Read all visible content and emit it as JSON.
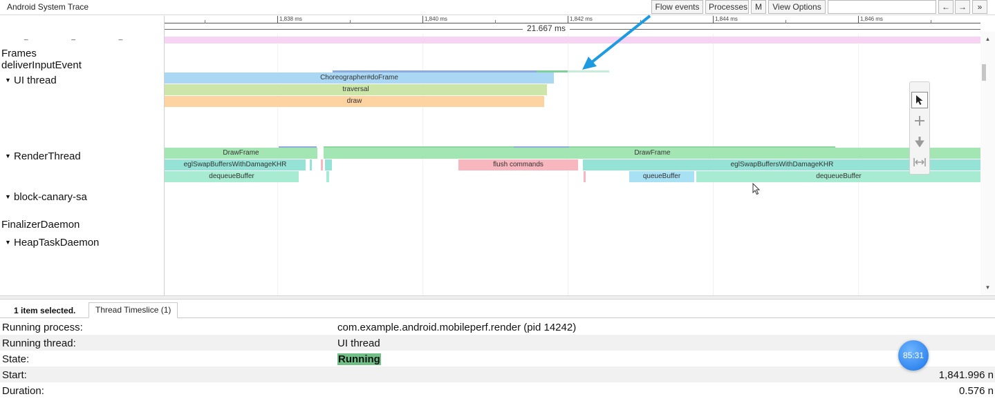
{
  "window": {
    "title": "Android System Trace"
  },
  "toolbar": {
    "flow_events": "Flow events",
    "processes": "Processes",
    "m": "M",
    "view_options": "View Options",
    "nav_left": "←",
    "nav_right": "→",
    "more": "»"
  },
  "ruler": {
    "ticks": [
      "1,838 ms",
      "1,840 ms",
      "1,842 ms",
      "1,844 ms",
      "1,846 ms"
    ],
    "span": "21.667 ms"
  },
  "tracks": {
    "dash_marks": "_ _ _",
    "frames": "Frames",
    "deliver_input_event": "deliverInputEvent",
    "ui_thread": "UI thread",
    "render_thread": "RenderThread",
    "block_canary": "block-canary-sa",
    "finalizer_daemon": "FinalizerDaemon",
    "heap_task_daemon": "HeapTaskDaemon",
    "expand_glyph": "▼"
  },
  "slices": {
    "choreographer": "Choreographer#doFrame",
    "traversal": "traversal",
    "draw": "draw",
    "drawframe_1": "DrawFrame",
    "drawframe_2": "DrawFrame",
    "egl_swap_1": "eglSwapBuffersWithDamageKHR",
    "flush_commands": "flush commands",
    "egl_swap_2": "eglSwapBuffersWithDamageKHR",
    "dequeue_1": "dequeueBuffer",
    "queue_buffer": "queueBuffer",
    "dequeue_2": "dequeueBuffer"
  },
  "scroll": {
    "up": "▲",
    "down": "▼"
  },
  "tools": {
    "select": "select-pointer-icon",
    "pan": "pan-move-icon",
    "zoom": "zoom-icon",
    "timing": "timing-range-icon"
  },
  "panel": {
    "selected_count": "1 item selected.",
    "tab": "Thread Timeslice (1)",
    "rows": [
      {
        "key": "Running process:",
        "value": "com.example.android.mobileperf.render (pid 14242)"
      },
      {
        "key": "Running thread:",
        "value": "UI thread"
      },
      {
        "key": "State:",
        "value": "Running"
      },
      {
        "key": "Start:",
        "value": "1,841.996 n"
      },
      {
        "key": "Duration:",
        "value": "0.576 n"
      }
    ]
  },
  "overlay": {
    "badge": "85:31"
  },
  "colors": {
    "state_running": "#6fbf87",
    "annotation_arrow": "#1e9be0",
    "frames_band": "#f8d4f4"
  }
}
